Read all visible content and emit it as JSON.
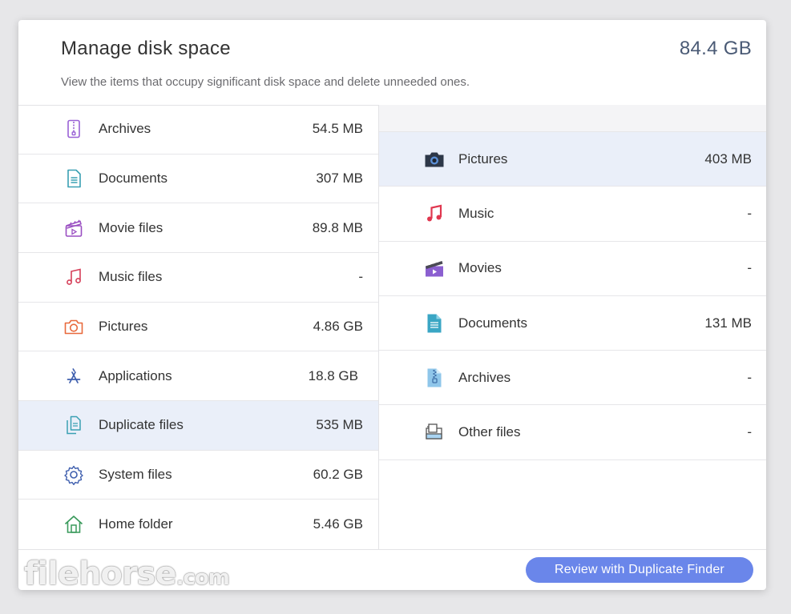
{
  "header": {
    "title": "Manage disk space",
    "total": "84.4 GB",
    "subtitle": "View the items that occupy significant disk space and delete unneeded ones."
  },
  "left_items": [
    {
      "label": "Archives",
      "value": "54.5 MB",
      "icon": "archive-icon"
    },
    {
      "label": "Documents",
      "value": "307 MB",
      "icon": "document-icon"
    },
    {
      "label": "Movie files",
      "value": "89.8 MB",
      "icon": "movie-icon"
    },
    {
      "label": "Music files",
      "value": "-",
      "icon": "music-icon"
    },
    {
      "label": "Pictures",
      "value": "4.86 GB",
      "icon": "camera-icon"
    },
    {
      "label": "Applications",
      "value": "18.8 GB",
      "icon": "app-store-icon"
    },
    {
      "label": "Duplicate files",
      "value": "535 MB",
      "icon": "duplicate-icon",
      "selected": true
    },
    {
      "label": "System files",
      "value": "60.2 GB",
      "icon": "gear-icon"
    },
    {
      "label": "Home folder",
      "value": "5.46 GB",
      "icon": "home-icon"
    }
  ],
  "right_items": [
    {
      "label": "Pictures",
      "value": "403 MB",
      "icon": "camera-icon",
      "selected": true
    },
    {
      "label": "Music",
      "value": "-",
      "icon": "music-icon"
    },
    {
      "label": "Movies",
      "value": "-",
      "icon": "movie-icon"
    },
    {
      "label": "Documents",
      "value": "131 MB",
      "icon": "document-icon"
    },
    {
      "label": "Archives",
      "value": "-",
      "icon": "archive-icon"
    },
    {
      "label": "Other files",
      "value": "-",
      "icon": "other-files-icon"
    }
  ],
  "footer": {
    "button_label": "Review with Duplicate Finder",
    "watermark_main": "filehorse",
    "watermark_suffix": ".com"
  },
  "colors": {
    "accent": "#6a86ea",
    "selected_row": "#eaeff9",
    "total_text": "#4a5a75"
  }
}
